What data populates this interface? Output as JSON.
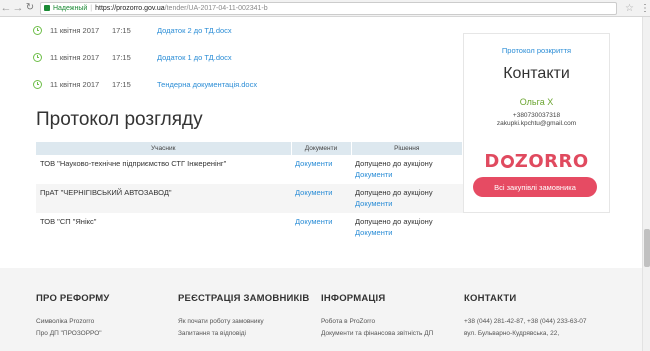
{
  "browser": {
    "secure_label": "Надежный",
    "url_domain": "https://prozorro.gov.ua",
    "url_path": "/tender/UA-2017-04-11-002341-b"
  },
  "documents": [
    {
      "date": "11 квітня 2017",
      "time": "17:15",
      "name": "Додаток 2 до ТД.docx"
    },
    {
      "date": "11 квітня 2017",
      "time": "17:15",
      "name": "Додаток 1 до ТД.docx"
    },
    {
      "date": "11 квітня 2017",
      "time": "17:15",
      "name": "Тендерна документація.docx"
    }
  ],
  "protocol": {
    "title": "Протокол розгляду",
    "columns": [
      "Учасник",
      "Документи",
      "Рішення"
    ],
    "rows": [
      {
        "participant": "ТОВ \"Науково-технічне підприємство СТГ Інжеренінг\"",
        "docs": "Документи",
        "decision": "Допущено до аукціону",
        "decision_docs": "Документи"
      },
      {
        "participant": "ПрАТ \"ЧЕРНІГІВСЬКИЙ АВТОЗАВОД\"",
        "docs": "Документи",
        "decision": "Допущено до аукціону",
        "decision_docs": "Документи"
      },
      {
        "participant": "ТОВ \"СП \"Янікс\"",
        "docs": "Документи",
        "decision": "Допущено до аукціону",
        "decision_docs": "Документи"
      }
    ]
  },
  "sidebar": {
    "protocol_link": "Протокол розкриття",
    "title": "Контакти",
    "name": "Ольга Х",
    "phone": "+380730037318",
    "email": "zakupki.kpchtu@gmail.com",
    "logo_text": "DOZORRO",
    "button": "Всі закупівлі замовника"
  },
  "footer": {
    "columns": [
      {
        "heading": "ПРО РЕФОРМУ",
        "links": [
          "Символіка Prozorro",
          "Про ДП \"ПРОЗОРРО\""
        ]
      },
      {
        "heading": "РЕЄСТРАЦІЯ ЗАМОВНИКІВ",
        "links": [
          "Як почати роботу замовнику",
          "Запитання та відповіді"
        ]
      },
      {
        "heading": "ІНФОРМАЦІЯ",
        "links": [
          "Робота в ProZorro",
          "Документи та фінансова звітність ДП"
        ]
      },
      {
        "heading": "КОНТАКТИ",
        "links": [
          "+38 (044) 281-42-87, +38 (044) 233-63-07",
          "вул. Бульварно-Кудрявська, 22,"
        ]
      }
    ]
  },
  "colors": {
    "link": "#2b8dd6",
    "accent": "#e64b63",
    "green": "#6aa42f"
  }
}
